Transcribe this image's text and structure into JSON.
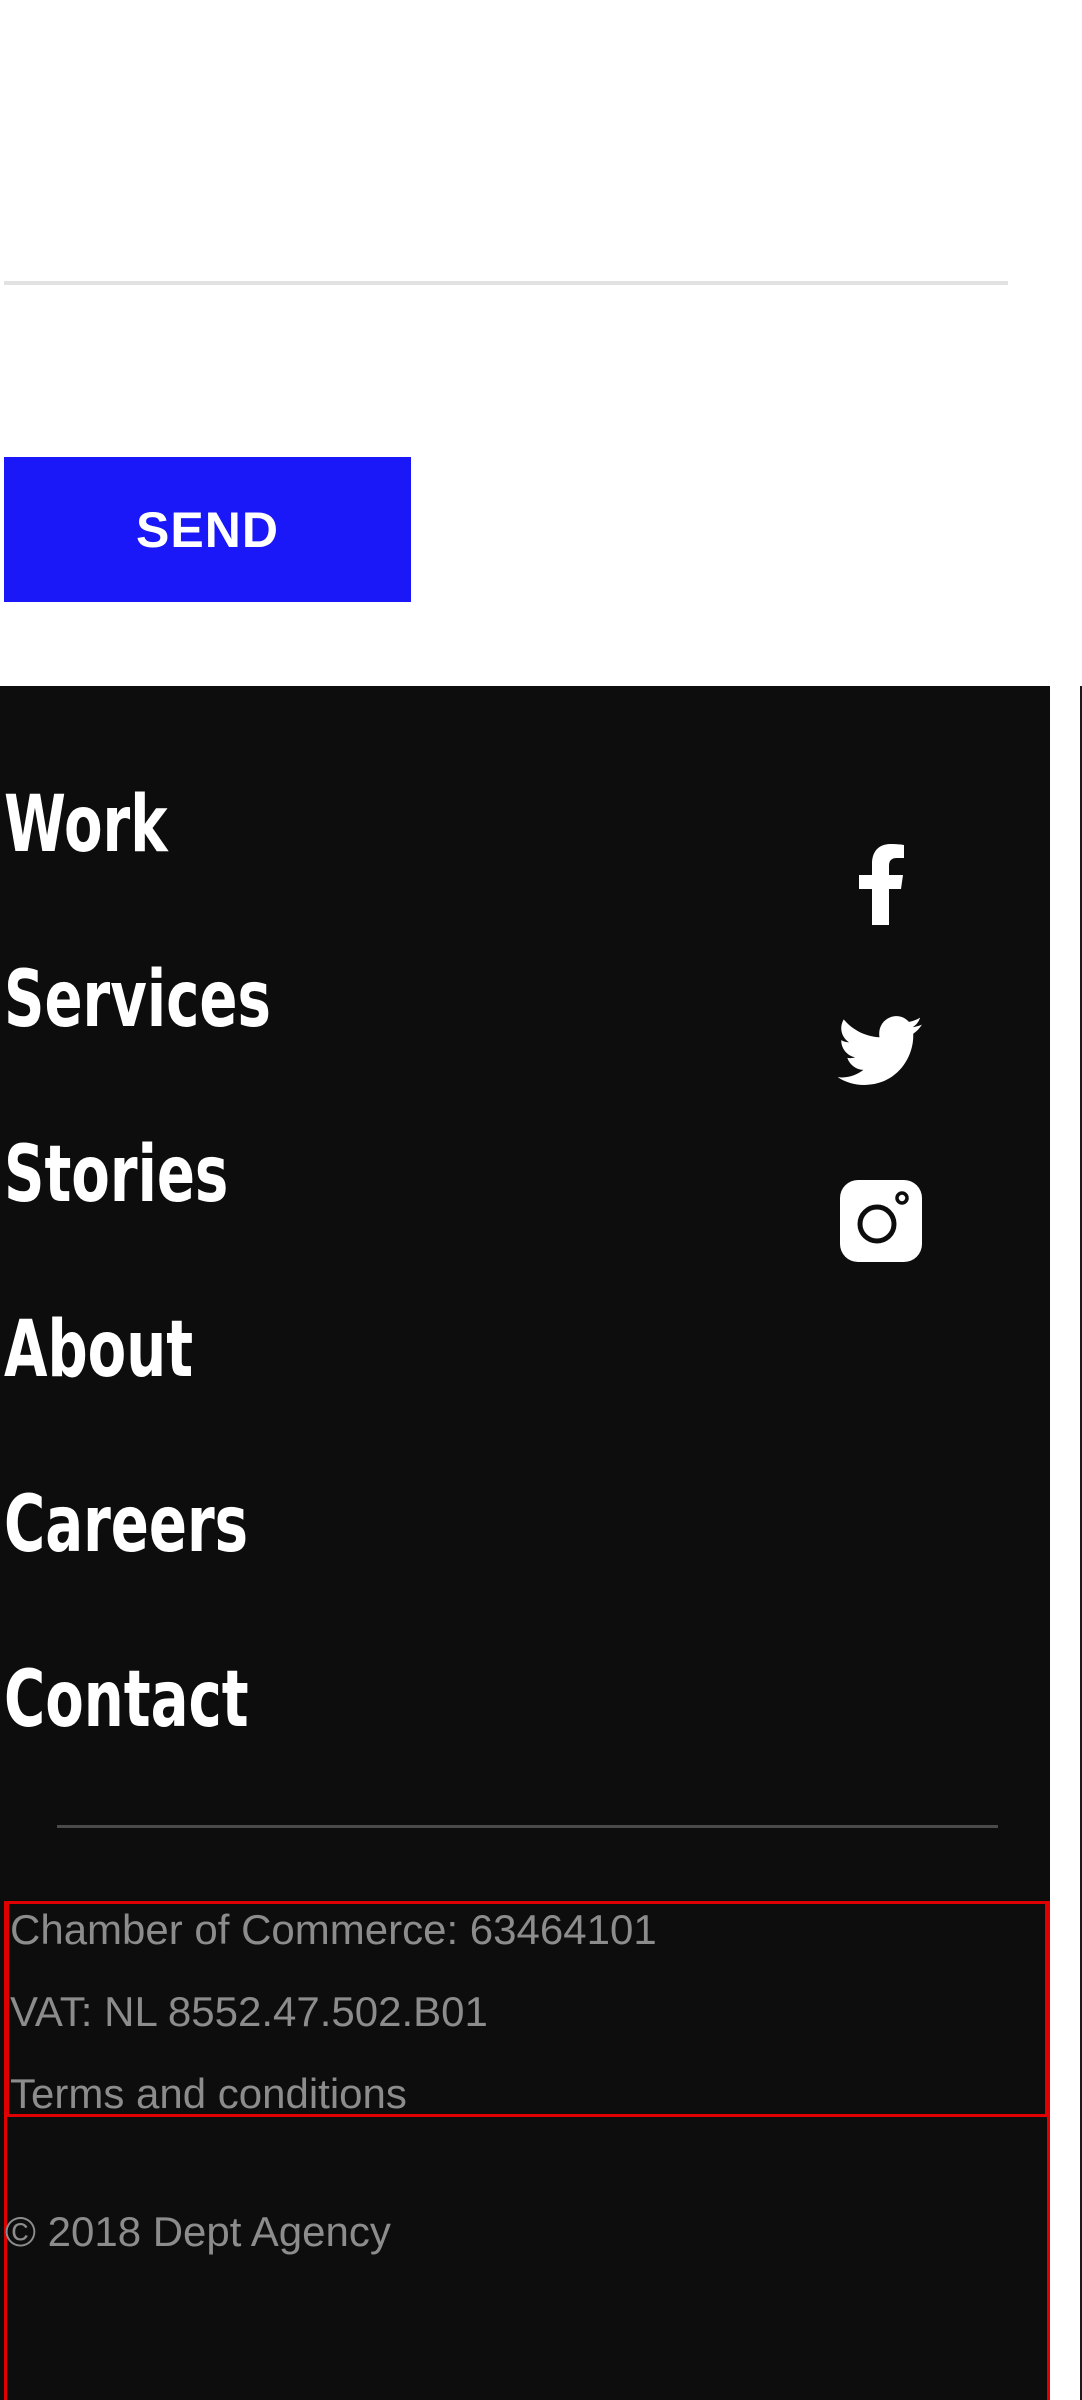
{
  "form": {
    "send_label": "SEND",
    "accent_color": "#1a17f8"
  },
  "footer": {
    "nav": [
      {
        "label": "Work"
      },
      {
        "label": "Services"
      },
      {
        "label": "Stories"
      },
      {
        "label": "About"
      },
      {
        "label": "Careers"
      },
      {
        "label": "Contact"
      }
    ],
    "social": [
      {
        "icon": "facebook-icon"
      },
      {
        "icon": "twitter-icon"
      },
      {
        "icon": "instagram-icon"
      }
    ],
    "legal": {
      "chamber": "Chamber of Commerce: 63464101",
      "vat": "VAT: NL 8552.47.502.B01",
      "terms": "Terms and conditions"
    },
    "copyright": "© 2018 Dept Agency",
    "background_color": "#0d0d0d",
    "text_muted_color": "#8c8c8c"
  }
}
